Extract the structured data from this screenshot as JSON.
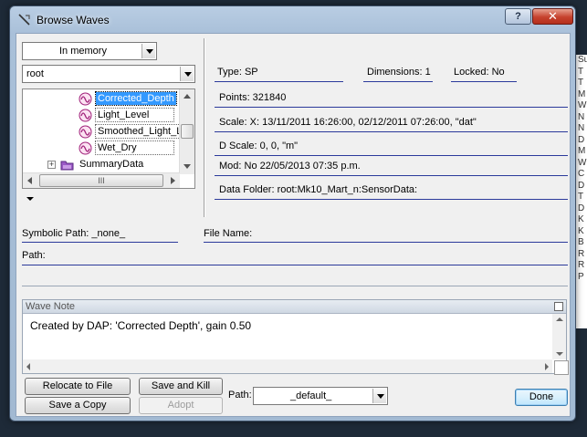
{
  "window": {
    "title": "Browse Waves",
    "help_label": "?",
    "close_label": "✕"
  },
  "source_combo": {
    "value": "In memory"
  },
  "folder_combo": {
    "value": "root"
  },
  "tree": {
    "items": [
      {
        "label": "Corrected_Depth",
        "selected": true
      },
      {
        "label": "Light_Level"
      },
      {
        "label": "Smoothed_Light_L"
      },
      {
        "label": "Wet_Dry"
      },
      {
        "label": "SummaryData",
        "expander": "+"
      }
    ],
    "hscroll_grip": "III"
  },
  "info": {
    "type": "Type:  SP",
    "dimensions": "Dimensions:  1",
    "locked": "Locked:  No",
    "points": "Points:  321840",
    "scale": "Scale:    X: 13/11/2011 16:26:00, 02/12/2011 07:26:00, \"dat\"",
    "dscale": "D Scale:  0, 0, \"m\"",
    "mod": "Mod:     No     22/05/2013 07:35 p.m.",
    "data_folder": "Data Folder:    root:Mk10_Mart_n:SensorData:"
  },
  "symbolic_path": "Symbolic Path:  _none_",
  "file_name": "File Name:",
  "path": "Path:",
  "wave_note": {
    "header": "Wave Note",
    "text": "Created by DAP: 'Corrected Depth', gain 0.50"
  },
  "buttons": {
    "relocate": "Relocate to File",
    "save_copy": "Save a Copy",
    "save_kill": "Save and Kill",
    "adopt": "Adopt",
    "done": "Done"
  },
  "path_combo": {
    "label": "Path:",
    "value": "_default_"
  },
  "background_strip": [
    "Su",
    "T",
    "T",
    "M",
    "W",
    "N",
    "N",
    "D",
    "M",
    "W",
    "C",
    "D",
    "T",
    "D",
    "K",
    "K",
    "B",
    "R",
    "R",
    "P"
  ]
}
